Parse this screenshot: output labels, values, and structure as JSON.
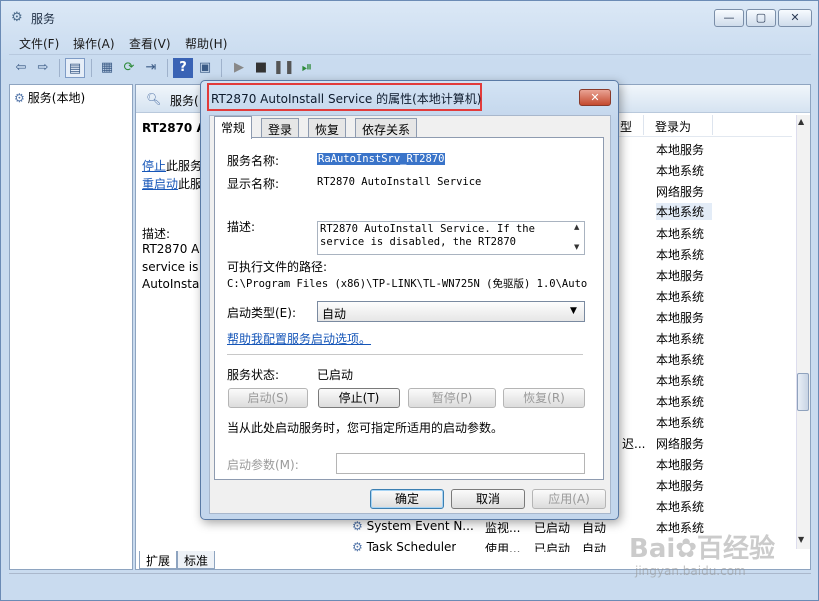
{
  "window": {
    "title": "服务",
    "controls": {
      "minimize": "—",
      "maximize": "▢",
      "close": "✕"
    }
  },
  "menu": [
    "文件(F)",
    "操作(A)",
    "查看(V)",
    "帮助(H)"
  ],
  "tree": {
    "root": "服务(本地)"
  },
  "services_panel": {
    "header": "服务(",
    "detail": {
      "name": "RT2870 Au",
      "stop_link": "停止",
      "stop_suffix": "此服务",
      "restart_link": "重启动",
      "restart_suffix": "此服",
      "desc_label": "描述:",
      "desc_lines": [
        "RT2870 Au",
        "service is d",
        "AutoInstall"
      ]
    },
    "columns": {
      "type_partial": "型",
      "logon": "登录为"
    },
    "logon_values": [
      "本地服务",
      "本地系统",
      "网络服务",
      "本地系统",
      "本地系统",
      "本地系统",
      "本地服务",
      "本地系统",
      "本地服务",
      "本地系统",
      "本地系统",
      "本地系统",
      "本地系统",
      "本地系统",
      "本地服务",
      "网络服务",
      "本地服务",
      "本地服务",
      "本地系统",
      "本地系统"
    ],
    "type_fragment": "迟...",
    "below_rows": [
      {
        "name": "System Event N...",
        "desc": "监视...",
        "status": "已启动",
        "startup": "自动"
      },
      {
        "name": "Task Scheduler",
        "desc": "使用...",
        "status": "已启动",
        "startup": "自动"
      }
    ],
    "bottom_tabs": [
      "扩展",
      "标准"
    ]
  },
  "dialog": {
    "title": "RT2870 AutoInstall Service 的属性(本地计算机)",
    "close": "✕",
    "tabs": [
      "常规",
      "登录",
      "恢复",
      "依存关系"
    ],
    "service_name_label": "服务名称:",
    "service_name_value": "RaAutoInstSrv_RT2870",
    "display_name_label": "显示名称:",
    "display_name_value": "RT2870 AutoInstall Service",
    "description_label": "描述:",
    "description_value": "RT2870 AutoInstall Service. If the service is disabled, the RT2870",
    "exe_path_label": "可执行文件的路径:",
    "exe_path_value": "C:\\Program Files (x86)\\TP-LINK\\TL-WN725N (免驱版) 1.0\\AutoIn",
    "startup_type_label": "启动类型(E):",
    "startup_type_value": "自动",
    "help_link": "帮助我配置服务启动选项。",
    "status_label": "服务状态:",
    "status_value": "已启动",
    "buttons": {
      "start": "启动(S)",
      "stop": "停止(T)",
      "pause": "暂停(P)",
      "resume": "恢复(R)"
    },
    "hint": "当从此处启动服务时，您可指定所适用的启动参数。",
    "params_label": "启动参数(M):",
    "params_value": "",
    "footer": {
      "ok": "确定",
      "cancel": "取消",
      "apply": "应用(A)"
    }
  },
  "watermark": {
    "logo": "Bai✿百经验",
    "url": "jingyan.baidu.com"
  },
  "colors": {
    "accent": "#3a74c9",
    "highlight_box": "#e23b3b",
    "link": "#1656b8"
  }
}
